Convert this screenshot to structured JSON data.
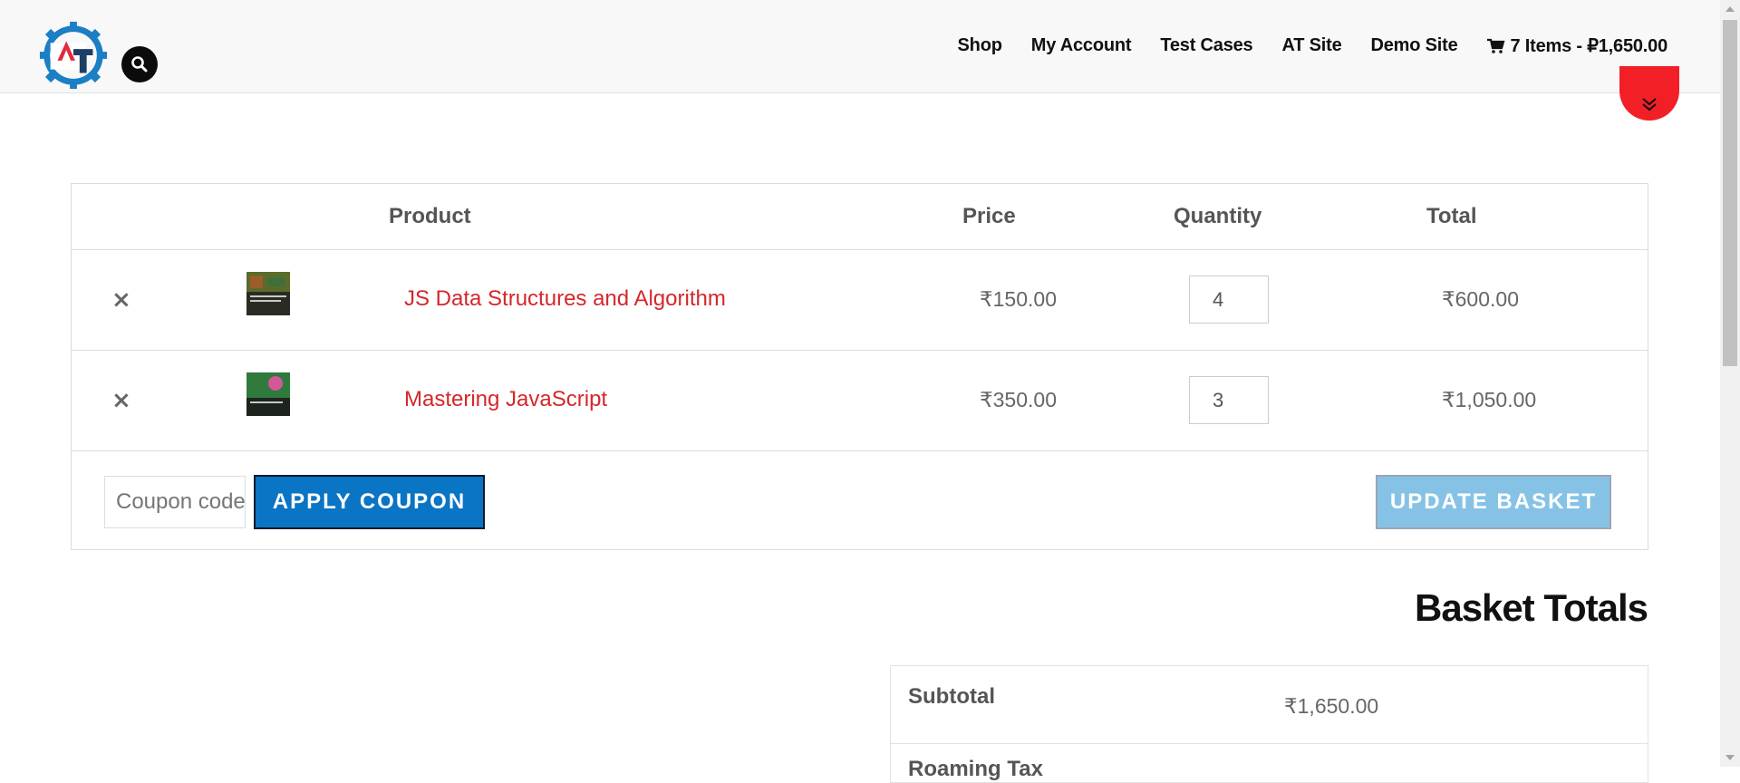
{
  "header": {
    "nav": [
      {
        "label": "Shop"
      },
      {
        "label": "My Account"
      },
      {
        "label": "Test Cases"
      },
      {
        "label": "AT Site"
      },
      {
        "label": "Demo Site"
      }
    ],
    "cart_label": "7 Items - ₽1,650.00",
    "icons": {
      "logo": "automation-testing-logo",
      "search": "search-icon",
      "cart": "cart-icon",
      "scroll": "chevron-double-down-icon"
    }
  },
  "cart": {
    "headers": {
      "product": "Product",
      "price": "Price",
      "quantity": "Quantity",
      "total": "Total"
    },
    "items": [
      {
        "remove": "×",
        "name": "JS Data Structures and Algorithm",
        "price": "₹150.00",
        "quantity": "4",
        "total": "₹600.00"
      },
      {
        "remove": "×",
        "name": "Mastering JavaScript",
        "price": "₹350.00",
        "quantity": "3",
        "total": "₹1,050.00"
      }
    ],
    "coupon_placeholder": "Coupon code",
    "apply_label": "APPLY COUPON",
    "update_label": "UPDATE BASKET"
  },
  "totals": {
    "title": "Basket Totals",
    "subtotal_label": "Subtotal",
    "subtotal_value": "₹1,650.00",
    "next_label": "Roaming Tax"
  },
  "colors": {
    "accent": "#d4272a",
    "button": "#0a74c5",
    "button_disabled": "#86c2e6",
    "scroll_button": "#f21f26"
  }
}
